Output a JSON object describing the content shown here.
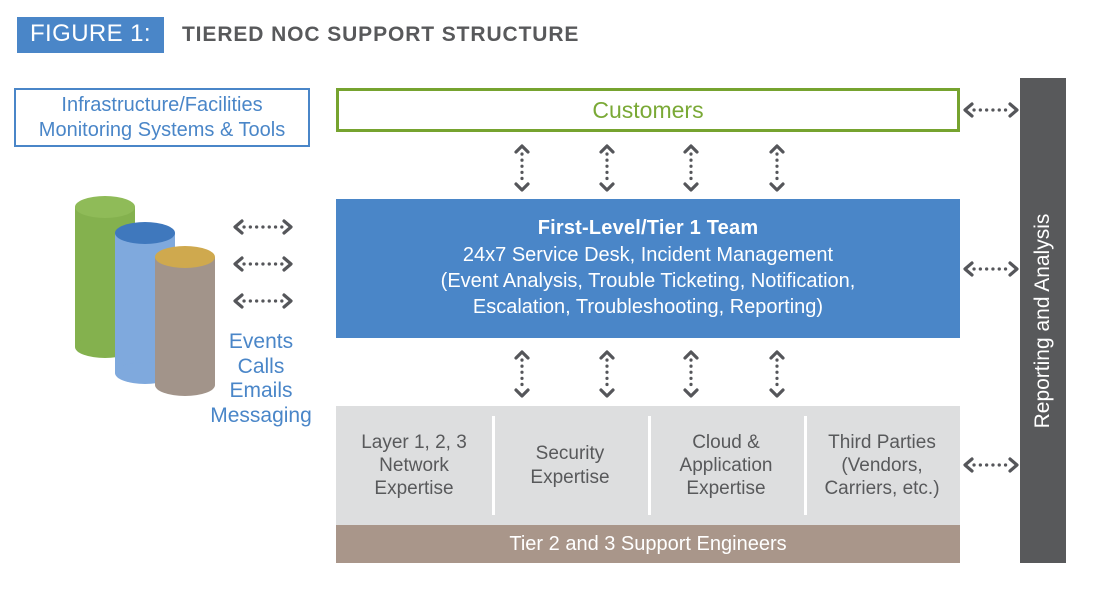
{
  "header": {
    "badge": "FIGURE 1:",
    "title": "TIERED NOC SUPPORT STRUCTURE",
    "badge_color": "#4a86c8",
    "title_color": "#58595b"
  },
  "left_panel": {
    "infrastructure_box": {
      "line1": "Infrastructure/Facilities",
      "line2": "Monitoring Systems & Tools",
      "border_color": "#4a86c8",
      "text_color": "#4a86c8"
    },
    "cylinders": [
      {
        "name": "green-cylinder",
        "color": "#84b14e",
        "top_color": "#8fbb58"
      },
      {
        "name": "blue-cylinder",
        "color": "#7fa9dd",
        "top_color": "#3f78bd"
      },
      {
        "name": "tan-cylinder",
        "color": "#a2948a",
        "top_color": "#cfa94e"
      }
    ],
    "connectors": [
      {
        "name": "connector-events"
      },
      {
        "name": "connector-calls"
      },
      {
        "name": "connector-emails"
      }
    ],
    "input_labels": [
      "Events",
      "Calls",
      "Emails",
      "Messaging"
    ],
    "input_labels_color": "#4a86c8"
  },
  "customers": {
    "label": "Customers",
    "border_color": "#76a32f",
    "text_color": "#7aa936"
  },
  "tier1": {
    "title": "First-Level/Tier 1 Team",
    "lines": [
      "24x7 Service Desk, Incident Management",
      "(Event Analysis, Trouble Ticketing, Notification,",
      "Escalation, Troubleshooting, Reporting)"
    ],
    "background": "#4a86c8",
    "text_color": "#ffffff"
  },
  "expertise": {
    "background": "#dddedf",
    "text_color": "#58595b",
    "columns": [
      {
        "name": "network-expertise",
        "lines": [
          "Layer 1, 2, 3",
          "Network",
          "Expertise"
        ]
      },
      {
        "name": "security-expertise",
        "lines": [
          "Security",
          "Expertise"
        ]
      },
      {
        "name": "cloud-application-expertise",
        "lines": [
          "Cloud &",
          "Application",
          "Expertise"
        ]
      },
      {
        "name": "third-parties",
        "lines": [
          "Third Parties",
          "(Vendors,",
          "Carriers, etc.)"
        ]
      }
    ]
  },
  "tier23": {
    "label": "Tier 2 and 3 Support Engineers",
    "background": "#a9968a",
    "text_color": "#ffffff"
  },
  "reporting": {
    "label": "Reporting and Analysis",
    "background": "#58595b",
    "text_color": "#ffffff"
  },
  "flow_arrows": {
    "top_row_count": 4,
    "bottom_row_count": 4,
    "color": "#55565a"
  },
  "right_connectors": [
    {
      "name": "connector-customers-to-reporting"
    },
    {
      "name": "connector-tier1-to-reporting"
    },
    {
      "name": "connector-expertise-to-reporting"
    }
  ]
}
